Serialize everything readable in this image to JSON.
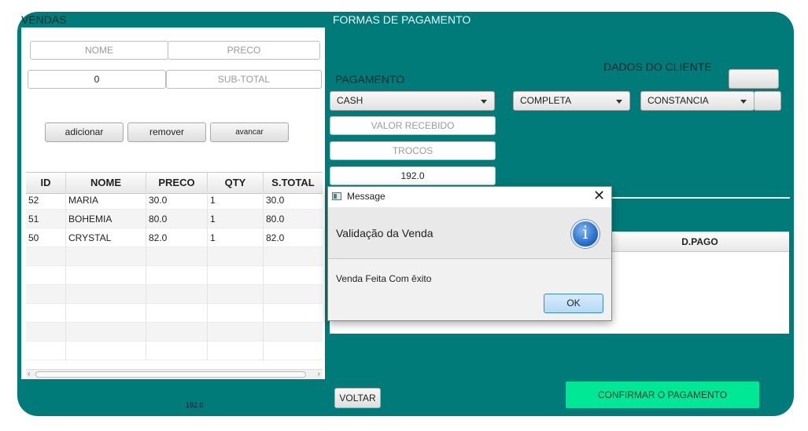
{
  "vendas": {
    "title": "VENDAS",
    "nome_placeholder": "NOME",
    "preco_placeholder": "PRECO",
    "quantity_value": "0",
    "subtotal_placeholder": "SUB-TOTAL",
    "buttons": {
      "adicionar": "adicionar",
      "remover": "remover",
      "avancar": "avancar"
    },
    "table": {
      "columns": [
        "ID",
        "NOME",
        "PRECO",
        "QTY",
        "S.TOTAL"
      ],
      "rows": [
        [
          "52",
          "MARIA",
          "30.0",
          "1",
          "30.0"
        ],
        [
          "51",
          "BOHEMIA",
          "80.0",
          "1",
          "80.0"
        ],
        [
          "50",
          "CRYSTAL",
          "82.0",
          "1",
          "82.0"
        ]
      ]
    },
    "total_label": "192.0"
  },
  "pagamento": {
    "section_title": "FORMAS DE PAGAMENTO",
    "label": "PAGAMENTO",
    "method": "CASH",
    "valor_recebido_placeholder": "VALOR RECEBIDO",
    "trocos_placeholder": "TROCOS",
    "total_value": "192.0"
  },
  "cliente": {
    "title": "DADOS DO CLIENTE",
    "tipo": "COMPLETA",
    "documento": "CONSTANCIA",
    "table_header": "D.PAGO"
  },
  "actions": {
    "voltar": "VOLTAR",
    "confirmar": "CONFIRMAR O PAGAMENTO"
  },
  "dialog": {
    "title": "Message",
    "header": "Validação da Venda",
    "message": "Venda Feita Com êxito",
    "ok": "OK",
    "icon": "info-icon"
  },
  "colors": {
    "panel": "#007b79",
    "confirm": "#00e896",
    "ok_border": "#3f86c6"
  }
}
